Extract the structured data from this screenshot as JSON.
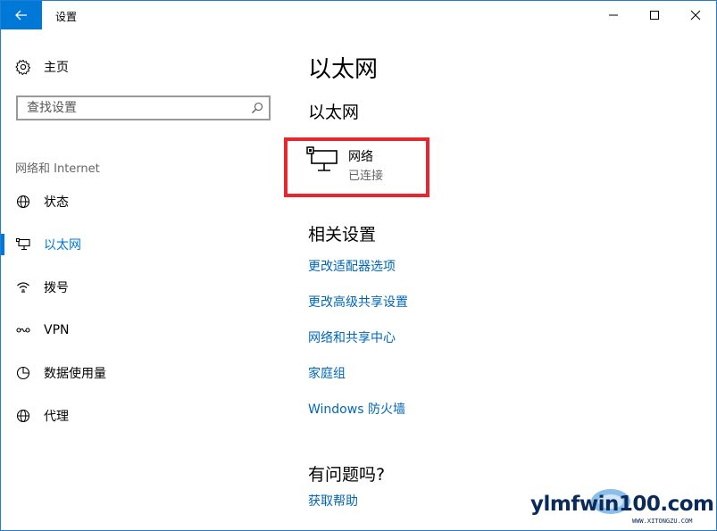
{
  "window": {
    "title": "设置"
  },
  "sidebar": {
    "home_label": "主页",
    "search_placeholder": "查找设置",
    "category": "网络和 Internet",
    "items": [
      {
        "label": "状态",
        "icon": "globe-icon",
        "active": false
      },
      {
        "label": "以太网",
        "icon": "ethernet-icon",
        "active": true
      },
      {
        "label": "拨号",
        "icon": "dialup-icon",
        "active": false
      },
      {
        "label": "VPN",
        "icon": "vpn-icon",
        "active": false
      },
      {
        "label": "数据使用量",
        "icon": "data-usage-icon",
        "active": false
      },
      {
        "label": "代理",
        "icon": "globe-icon",
        "active": false
      }
    ]
  },
  "main": {
    "page_title": "以太网",
    "section_title": "以太网",
    "network": {
      "name": "网络",
      "status": "已连接"
    },
    "related_title": "相关设置",
    "related_links": [
      "更改适配器选项",
      "更改高级共享设置",
      "网络和共享中心",
      "家庭组",
      "Windows 防火墙"
    ],
    "help_title": "有问题吗?",
    "help_link": "获取帮助"
  },
  "watermark": {
    "text": "ylmfwin100.com",
    "sub": "WWW.XITONGZU.COM"
  },
  "colors": {
    "accent": "#0078d7",
    "link": "#0067b8",
    "highlight_border": "#e8262e"
  }
}
